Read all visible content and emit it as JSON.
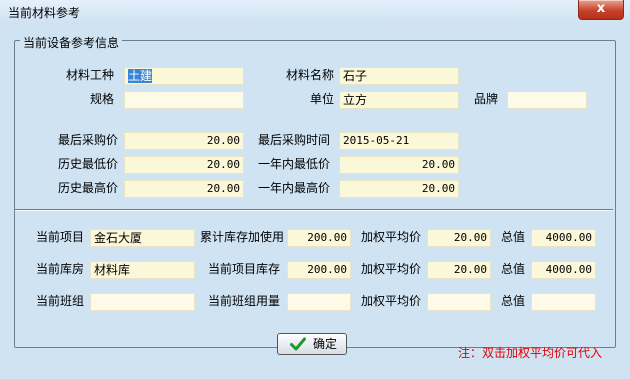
{
  "window": {
    "title": "当前材料参考",
    "close_glyph": "x"
  },
  "group_title": "当前设备参考信息",
  "material": {
    "type_label": "材料工种",
    "type_value": "土建",
    "name_label": "材料名称",
    "name_value": "石子",
    "spec_label": "规格",
    "spec_value": "",
    "unit_label": "单位",
    "unit_value": "立方",
    "brand_label": "品牌",
    "brand_value": ""
  },
  "price": {
    "last_price_label": "最后采购价",
    "last_price_value": "20.00",
    "last_time_label": "最后采购时间",
    "last_time_value": "2015-05-21",
    "hist_low_label": "历史最低价",
    "hist_low_value": "20.00",
    "year_low_label": "一年内最低价",
    "year_low_value": "20.00",
    "hist_high_label": "历史最高价",
    "hist_high_value": "20.00",
    "year_high_label": "一年内最高价",
    "year_high_value": "20.00"
  },
  "current": {
    "project_label": "当前项目",
    "project_value": "金石大厦",
    "cum_stock_label": "累计库存加使用",
    "cum_stock_value": "200.00",
    "wavg1_label": "加权平均价",
    "wavg1_value": "20.00",
    "total1_label": "总值",
    "total1_value": "4000.00",
    "warehouse_label": "当前库房",
    "warehouse_value": "材料库",
    "proj_stock_label": "当前项目库存",
    "proj_stock_value": "200.00",
    "wavg2_label": "加权平均价",
    "wavg2_value": "20.00",
    "total2_label": "总值",
    "total2_value": "4000.00",
    "team_label": "当前班组",
    "team_value": "",
    "team_usage_label": "当前班组用量",
    "team_usage_value": "",
    "wavg3_label": "加权平均价",
    "wavg3_value": "",
    "total3_label": "总值",
    "total3_value": ""
  },
  "buttons": {
    "ok_label": "确定"
  },
  "note": "注：双击加权平均价可代入",
  "colors": {
    "field_bg": "#fbf7d9",
    "dialog_bg": "#cfe3f3",
    "note": "#e00000",
    "check": "#1f9a2a"
  }
}
